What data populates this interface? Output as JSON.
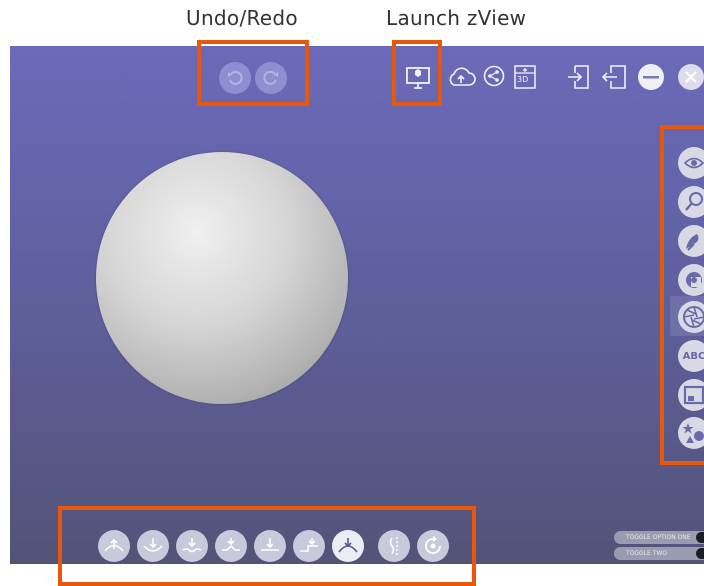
{
  "captions": {
    "undo_redo": "Undo/Redo",
    "launch_zview": "Launch zView"
  },
  "top_toolbar": {
    "items": [
      "undo-icon",
      "redo-icon",
      "launch-zview-icon",
      "cloud-upload-icon",
      "share-icon",
      "3d-view-icon",
      "import-icon",
      "export-icon",
      "minimize-icon",
      "close-icon"
    ],
    "badge_3d": "3D"
  },
  "right_toolbar": {
    "items": [
      "visibility-icon",
      "brush-icon",
      "smooth-icon",
      "material-icon",
      "aperture-icon",
      "text-icon",
      "image-icon",
      "shapes-icon"
    ],
    "text_icon_label": "ABC"
  },
  "bottom_toolbar": {
    "items": [
      "pull-up-icon",
      "push-down-icon",
      "pinch-down-icon",
      "crease-icon",
      "flatten-icon",
      "layer-icon",
      "ridge-icon",
      "symmetry-icon",
      "rotate-icon"
    ],
    "active_item": "ridge-icon"
  },
  "toggles": [
    {
      "label": "TOGGLE OPTION ONE",
      "state": "on"
    },
    {
      "label": "TOGGLE TWO",
      "state": "on"
    }
  ],
  "colors": {
    "highlight": "#e8580c",
    "viewport_top": "#6a6ab8",
    "viewport_bottom": "#535378"
  }
}
